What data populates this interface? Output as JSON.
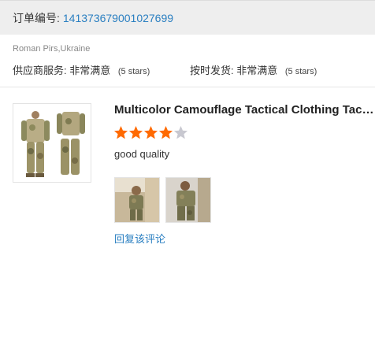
{
  "order": {
    "label": "订单编号:",
    "number": "141373679001027699"
  },
  "reviewer": {
    "name": "Roman Pirs,Ukraine"
  },
  "service": {
    "supplier_label": "供应商服务:",
    "supplier_value": "非常满意",
    "supplier_stars": "(5 stars)",
    "shipping_label": "按时发货:",
    "shipping_value": "非常满意",
    "shipping_stars": "(5 stars)"
  },
  "product": {
    "title": "Multicolor Camouflage Tactical Clothing Tactical Suit"
  },
  "review": {
    "rating": 4,
    "max_rating": 5,
    "text": "good quality",
    "reply_label": "回复该评论",
    "star_color": "#ff6a00",
    "star_empty_color": "#c8c8d0"
  },
  "colors": {
    "link": "#2a7fc1",
    "bar_bg": "#eeeeee"
  }
}
